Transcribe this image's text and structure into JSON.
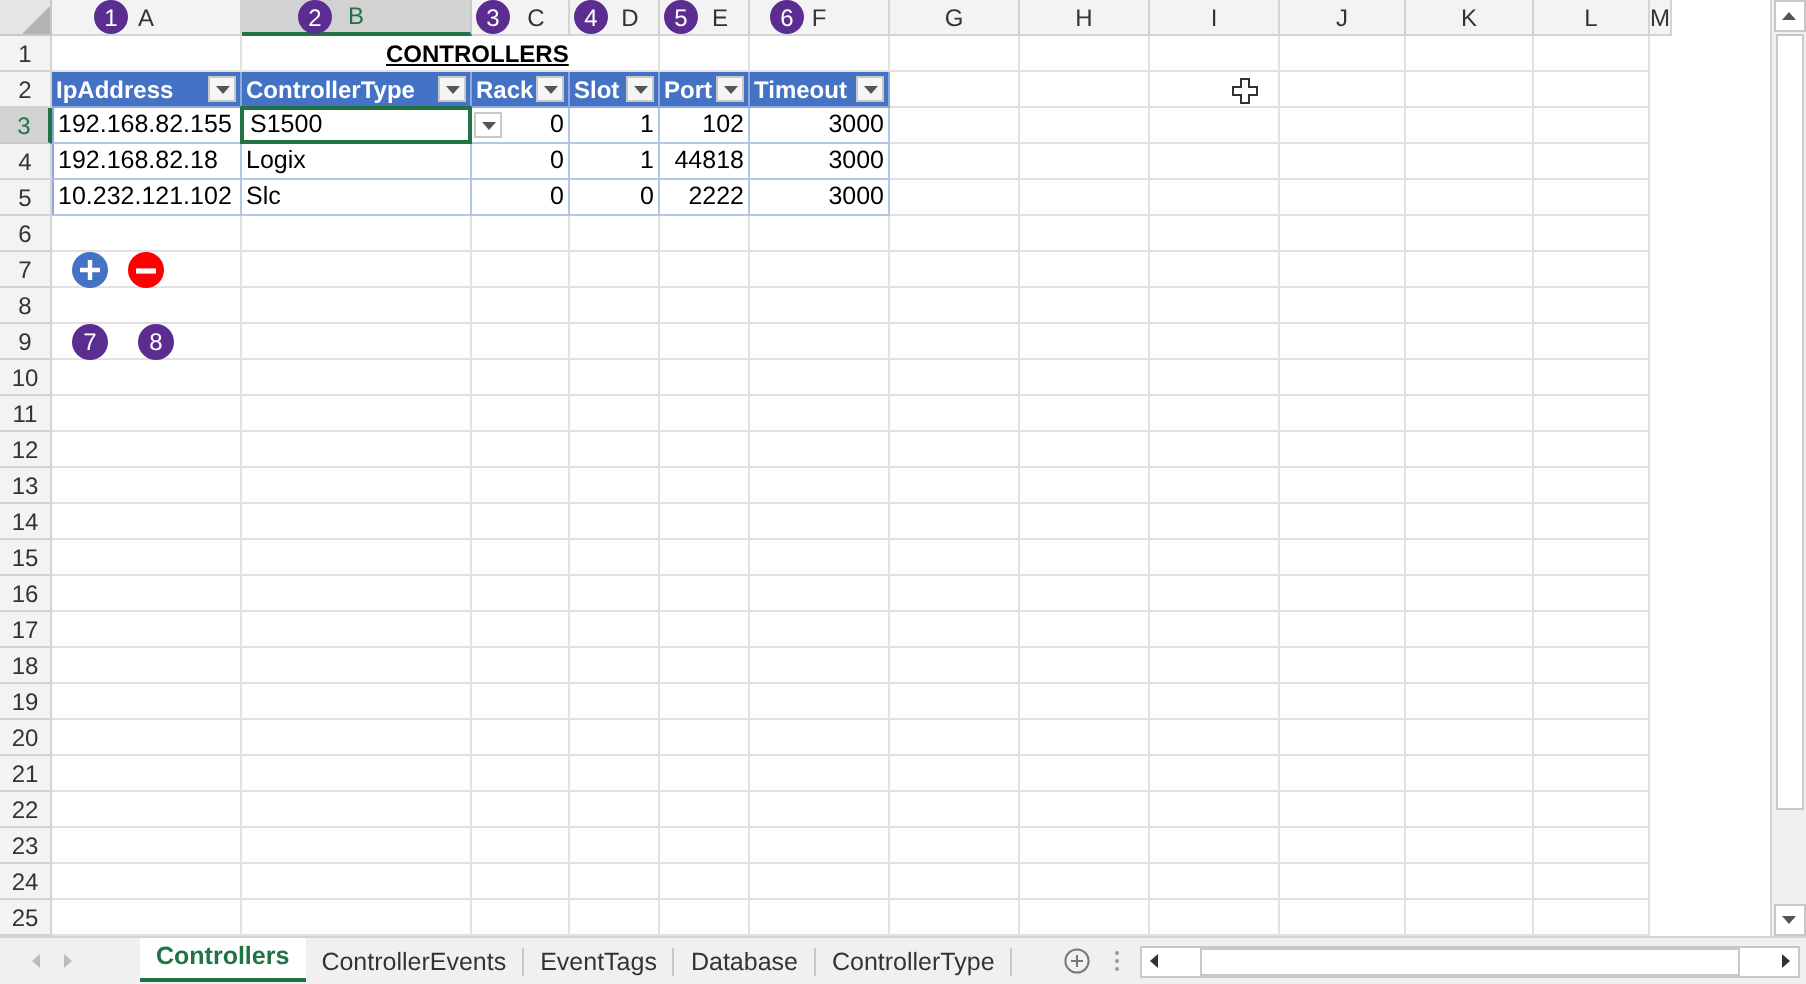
{
  "columns": [
    {
      "label": "A",
      "selected": false
    },
    {
      "label": "B",
      "selected": true
    },
    {
      "label": "C",
      "selected": false
    },
    {
      "label": "D",
      "selected": false
    },
    {
      "label": "E",
      "selected": false
    },
    {
      "label": "F",
      "selected": false
    },
    {
      "label": "G",
      "selected": false
    },
    {
      "label": "H",
      "selected": false
    },
    {
      "label": "I",
      "selected": false
    },
    {
      "label": "J",
      "selected": false
    },
    {
      "label": "K",
      "selected": false
    },
    {
      "label": "L",
      "selected": false
    },
    {
      "label": "M",
      "selected": false
    }
  ],
  "row_headers": [
    {
      "label": "1",
      "selected": false
    },
    {
      "label": "2",
      "selected": false
    },
    {
      "label": "3",
      "selected": true
    },
    {
      "label": "4",
      "selected": false
    },
    {
      "label": "5",
      "selected": false
    },
    {
      "label": "6",
      "selected": false
    },
    {
      "label": "7",
      "selected": false
    },
    {
      "label": "8",
      "selected": false
    },
    {
      "label": "9",
      "selected": false
    },
    {
      "label": "10",
      "selected": false
    },
    {
      "label": "11",
      "selected": false
    },
    {
      "label": "12",
      "selected": false
    },
    {
      "label": "13",
      "selected": false
    },
    {
      "label": "14",
      "selected": false
    },
    {
      "label": "15",
      "selected": false
    },
    {
      "label": "16",
      "selected": false
    },
    {
      "label": "17",
      "selected": false
    },
    {
      "label": "18",
      "selected": false
    },
    {
      "label": "19",
      "selected": false
    },
    {
      "label": "20",
      "selected": false
    },
    {
      "label": "21",
      "selected": false
    },
    {
      "label": "22",
      "selected": false
    },
    {
      "label": "23",
      "selected": false
    },
    {
      "label": "24",
      "selected": false
    },
    {
      "label": "25",
      "selected": false
    }
  ],
  "title": "CONTROLLERS",
  "table": {
    "columns": [
      {
        "label": "IpAddress",
        "kind": "text"
      },
      {
        "label": "ControllerType",
        "kind": "text"
      },
      {
        "label": "Rack",
        "kind": "number"
      },
      {
        "label": "Slot",
        "kind": "number"
      },
      {
        "label": "Port",
        "kind": "number"
      },
      {
        "label": "Timeout",
        "kind": "number"
      }
    ],
    "rows": [
      {
        "cells": [
          {
            "text": "192.168.82.155",
            "selected": false
          },
          {
            "text": "S1500",
            "selected": true
          },
          {
            "text": "0",
            "selected": false
          },
          {
            "text": "1",
            "selected": false
          },
          {
            "text": "102",
            "selected": false
          },
          {
            "text": "3000",
            "selected": false
          }
        ]
      },
      {
        "cells": [
          {
            "text": "192.168.82.18",
            "selected": false
          },
          {
            "text": "Logix",
            "selected": false
          },
          {
            "text": "0",
            "selected": false
          },
          {
            "text": "1",
            "selected": false
          },
          {
            "text": "44818",
            "selected": false
          },
          {
            "text": "3000",
            "selected": false
          }
        ]
      },
      {
        "cells": [
          {
            "text": "10.232.121.102",
            "selected": false
          },
          {
            "text": "Slc",
            "selected": false
          },
          {
            "text": "0",
            "selected": false
          },
          {
            "text": "0",
            "selected": false
          },
          {
            "text": "2222",
            "selected": false
          },
          {
            "text": "3000",
            "selected": false
          }
        ]
      }
    ]
  },
  "buttons": [
    {
      "kind": "add"
    },
    {
      "kind": "remove"
    }
  ],
  "callouts": [
    "1",
    "2",
    "3",
    "4",
    "5",
    "6",
    "7",
    "8"
  ],
  "sheet_tabs": [
    {
      "label": "Controllers",
      "selected": true
    },
    {
      "label": "ControllerEvents",
      "selected": false
    },
    {
      "label": "EventTags",
      "selected": false
    },
    {
      "label": "Database",
      "selected": false
    },
    {
      "label": "ControllerType",
      "selected": false
    }
  ]
}
